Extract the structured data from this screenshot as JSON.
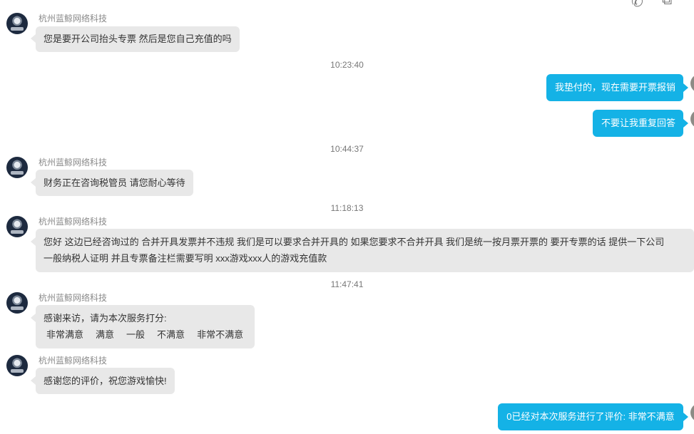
{
  "sender_name": "杭州蓝鲸网络科技",
  "messages": {
    "m1": "您是要开公司抬头专票 然后是您自己充值的吗",
    "t1": "10:23:40",
    "r1": "我垫付的，现在需要开票报销",
    "r2": "不要让我重复回答",
    "t2": "10:44:37",
    "m2": "财务正在咨询税管员 请您耐心等待",
    "t3": "11:18:13",
    "m3_line1": "您好 这边已经咨询过的 合并开具发票并不违规 我们是可以要求合并开具的 如果您要求不合并开具 我们是统一按月票开票的 要开专票的话 提供一下公司",
    "m3_line2": "一般纳税人证明 并且专票备注栏需要写明 xxx游戏xxx人的游戏充值款",
    "t4": "11:47:41",
    "m4_line1": "感谢来访，请为本次服务打分:",
    "rating_options": [
      "非常满意",
      "满意",
      "一般",
      "不满意",
      "非常不满意"
    ],
    "m5": "感谢您的评价，祝您游戏愉快!",
    "r3": "0已经对本次服务进行了评价: 非常不满意"
  },
  "icons": {
    "top_phone": "phone-icon",
    "top_window": "window-icon"
  },
  "colors": {
    "agent_bubble": "#e8e8e8",
    "user_bubble": "#14b2e6"
  }
}
